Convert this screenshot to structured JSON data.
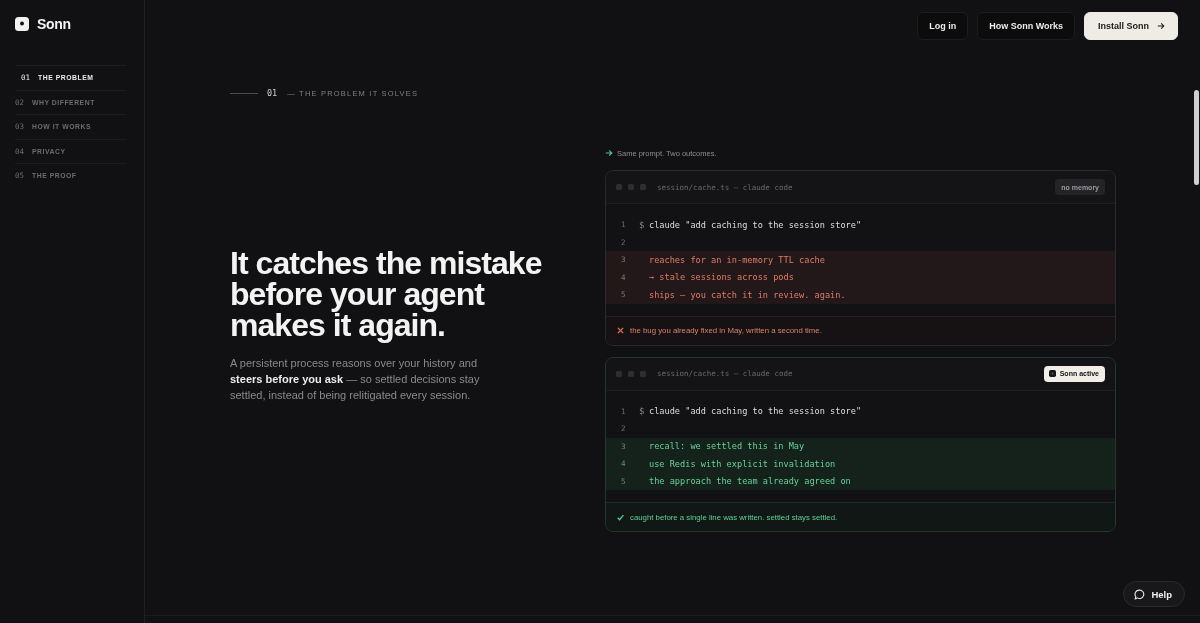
{
  "brand": {
    "name": "Sonn"
  },
  "sidebar": {
    "items": [
      {
        "number": "01",
        "label": "THE PROBLEM",
        "selected": true
      },
      {
        "number": "02",
        "label": "WHY DIFFERENT",
        "selected": false
      },
      {
        "number": "03",
        "label": "HOW IT WORKS",
        "selected": false
      },
      {
        "number": "04",
        "label": "PRIVACY",
        "selected": false
      },
      {
        "number": "05",
        "label": "THE PROOF",
        "selected": false
      }
    ]
  },
  "header": {
    "buttons": [
      {
        "label": "Log in",
        "kind": "dark"
      },
      {
        "label": "How Sonn Works",
        "kind": "dark"
      },
      {
        "label": "Install Sonn",
        "kind": "primary"
      }
    ]
  },
  "section": {
    "number": "01",
    "title": "— THE PROBLEM IT SOLVES"
  },
  "hero": {
    "headline": "It catches the mistake before your agent makes it again.",
    "body": "A persistent process reasons over your history and **steers before you ask** — so settled decisions stay settled, instead of being relitigated every session."
  },
  "comparison": {
    "caption": "Same prompt. Two outcomes.",
    "panels": [
      {
        "kind": "failure",
        "title": "session/cache.ts — claude code",
        "badge": "no memory",
        "lines": [
          {
            "number": "1",
            "prompt": "$",
            "text": "claude \"add caching to the session store\"",
            "highlighted": false
          },
          {
            "number": "2",
            "highlighted": false
          },
          {
            "number": "3",
            "text": "reaches for an in-memory TTL cache",
            "highlighted": true
          },
          {
            "number": "4",
            "text": "→ stale sessions across pods",
            "highlighted": true
          },
          {
            "number": "5",
            "text": "ships — you catch it in review. again.",
            "highlighted": true
          }
        ],
        "footer": "the bug you already fixed in May, written a second time."
      },
      {
        "kind": "success",
        "title": "session/cache.ts — claude code",
        "badge": "Sonn active",
        "lines": [
          {
            "number": "1",
            "prompt": "$",
            "text": "claude \"add caching to the session store\"",
            "highlighted": false
          },
          {
            "number": "2",
            "highlighted": false
          },
          {
            "number": "3",
            "text": "recall: we settled this in May",
            "highlighted": true
          },
          {
            "number": "4",
            "text": "use Redis with explicit invalidation",
            "highlighted": true
          },
          {
            "number": "5",
            "text": "the approach the team already agreed on",
            "highlighted": true
          }
        ],
        "footer": "caught before a single line was written. settled stays settled."
      }
    ]
  },
  "help_button": {
    "label": "Help"
  }
}
